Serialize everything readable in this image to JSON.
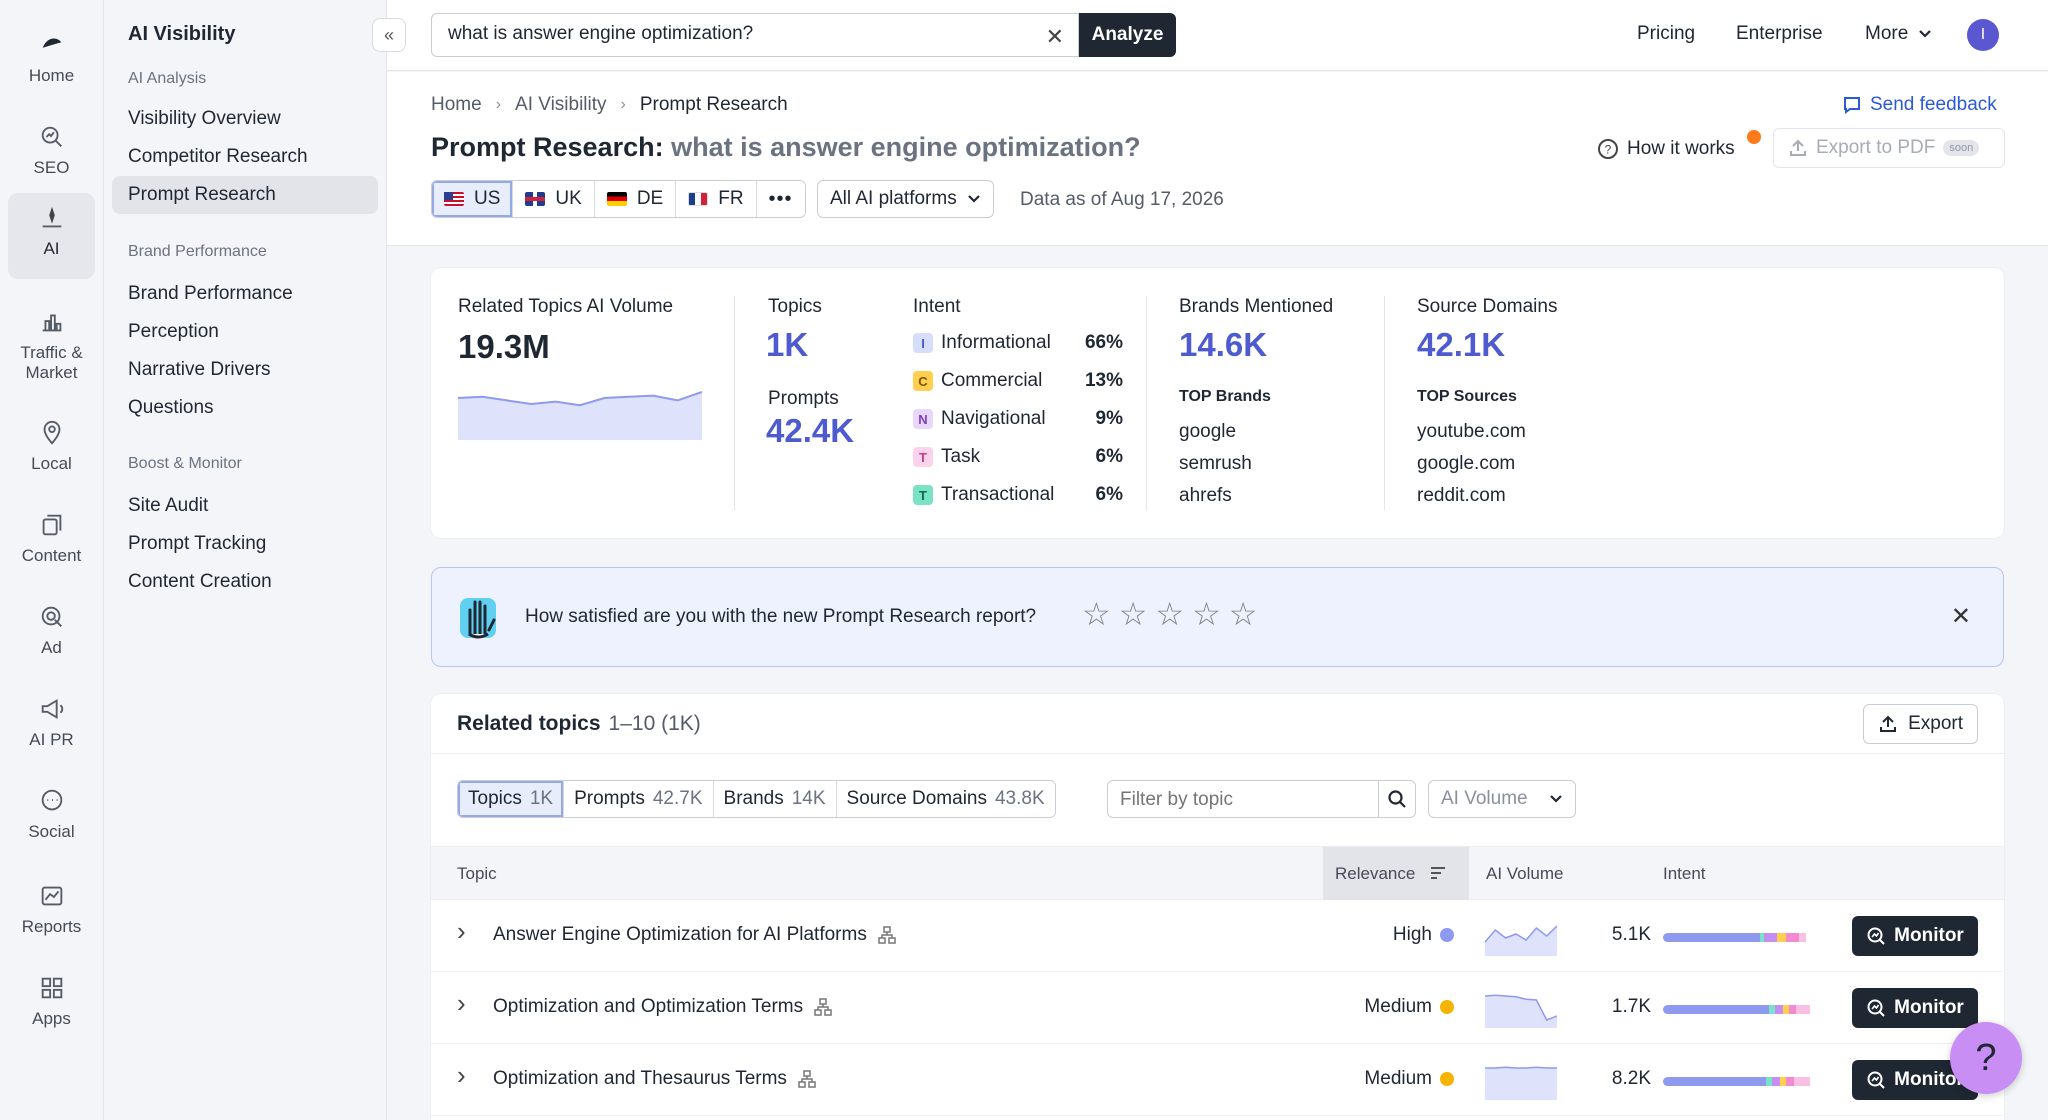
{
  "rail": [
    {
      "label": "Home",
      "icon": "home-icon"
    },
    {
      "label": "SEO",
      "icon": "seo-icon"
    },
    {
      "label": "AI",
      "icon": "ai-icon"
    },
    {
      "label": "Traffic & Market",
      "icon": "chart-icon"
    },
    {
      "label": "Local",
      "icon": "location-icon"
    },
    {
      "label": "Content",
      "icon": "content-icon"
    },
    {
      "label": "Ad",
      "icon": "ad-icon"
    },
    {
      "label": "AI PR",
      "icon": "megaphone-icon"
    },
    {
      "label": "Social",
      "icon": "chat-icon"
    },
    {
      "label": "Reports",
      "icon": "reports-icon"
    },
    {
      "label": "Apps",
      "icon": "apps-icon"
    }
  ],
  "sidebar": {
    "title": "AI Visibility",
    "groups": [
      {
        "label": "AI Analysis",
        "items": [
          "Visibility Overview",
          "Competitor Research",
          "Prompt Research"
        ]
      },
      {
        "label": "Brand Performance",
        "items": [
          "Brand Performance",
          "Perception",
          "Narrative Drivers",
          "Questions"
        ]
      },
      {
        "label": "Boost & Monitor",
        "items": [
          "Site Audit",
          "Prompt Tracking",
          "Content Creation"
        ]
      }
    ]
  },
  "topbar": {
    "search_value": "what is answer engine optimization?",
    "analyze_label": "Analyze",
    "links": [
      "Pricing",
      "Enterprise",
      "More"
    ],
    "avatar_letter": "I"
  },
  "header": {
    "breadcrumbs": [
      "Home",
      "AI Visibility",
      "Prompt Research"
    ],
    "title_prefix": "Prompt Research:",
    "title_query": "what is answer engine optimization?",
    "send_feedback": "Send feedback",
    "how_it_works": "How it works",
    "export_pdf": "Export to PDF",
    "soon": "soon",
    "countries": [
      "US",
      "UK",
      "DE",
      "FR"
    ],
    "more_countries": "•••",
    "platform": "All AI platforms",
    "data_as_of": "Data as of Aug 17, 2026"
  },
  "stats": {
    "volume_label": "Related Topics AI Volume",
    "volume_value": "19.3M",
    "volume_trend": [
      0.7,
      0.72,
      0.66,
      0.6,
      0.64,
      0.58,
      0.7,
      0.72,
      0.74,
      0.66,
      0.8
    ],
    "topics_label": "Topics",
    "topics_value": "1K",
    "prompts_label": "Prompts",
    "prompts_value": "42.4K",
    "intent_label": "Intent",
    "intents": [
      {
        "letter": "I",
        "name": "Informational",
        "pct": "66%",
        "bg": "#d7defb",
        "fg": "#4a5bd0"
      },
      {
        "letter": "C",
        "name": "Commercial",
        "pct": "13%",
        "bg": "#ffcf4d",
        "fg": "#7a5200"
      },
      {
        "letter": "N",
        "name": "Navigational",
        "pct": "9%",
        "bg": "#e9d7fb",
        "fg": "#7b3fc4"
      },
      {
        "letter": "T",
        "name": "Task",
        "pct": "6%",
        "bg": "#fcd3ec",
        "fg": "#c23d8a"
      },
      {
        "letter": "T",
        "name": "Transactional",
        "pct": "6%",
        "bg": "#7be3c5",
        "fg": "#0e6b52"
      }
    ],
    "brands_label": "Brands Mentioned",
    "brands_value": "14.6K",
    "top_brands_label": "TOP Brands",
    "top_brands": [
      "google",
      "semrush",
      "ahrefs"
    ],
    "sources_label": "Source Domains",
    "sources_value": "42.1K",
    "top_sources_label": "TOP Sources",
    "top_sources": [
      "youtube.com",
      "google.com",
      "reddit.com"
    ]
  },
  "survey": {
    "question": "How satisfied are you with the new Prompt Research report?",
    "stars": 5
  },
  "topics": {
    "title": "Related topics",
    "range": "1–10 (1K)",
    "export_label": "Export",
    "tabs": [
      {
        "label": "Topics",
        "count": "1K"
      },
      {
        "label": "Prompts",
        "count": "42.7K"
      },
      {
        "label": "Brands",
        "count": "14K"
      },
      {
        "label": "Source Domains",
        "count": "43.8K"
      }
    ],
    "filter_placeholder": "Filter by topic",
    "volume_select": "AI Volume",
    "columns": [
      "Topic",
      "Relevance",
      "AI Volume",
      "Intent"
    ],
    "monitor_label": "Monitor",
    "rows": [
      {
        "topic": "Answer Engine Optimization for AI Platforms",
        "relevance": "High",
        "dot": "#8e9af0",
        "volume": "5.1K",
        "spark": [
          0.35,
          0.65,
          0.45,
          0.55,
          0.4,
          0.7,
          0.5,
          0.75
        ],
        "intent_mix": [
          0.62,
          0.03,
          0.08,
          0.06,
          0.08,
          0.05
        ]
      },
      {
        "topic": "Optimization and Optimization Terms",
        "relevance": "Medium",
        "dot": "#f4b400",
        "volume": "1.7K",
        "spark": [
          0.8,
          0.82,
          0.8,
          0.78,
          0.72,
          0.7,
          0.2,
          0.3
        ],
        "intent_mix": [
          0.68,
          0.04,
          0.05,
          0.04,
          0.04,
          0.09
        ]
      },
      {
        "topic": "Optimization and Thesaurus Terms",
        "relevance": "Medium",
        "dot": "#f4b400",
        "volume": "8.2K",
        "spark": [
          0.8,
          0.8,
          0.82,
          0.8,
          0.8,
          0.82,
          0.8,
          0.8
        ],
        "intent_mix": [
          0.66,
          0.04,
          0.05,
          0.04,
          0.05,
          0.1
        ]
      }
    ],
    "intent_colors": [
      "#8e9af0",
      "#7be3c5",
      "#c58ef3",
      "#ffcf4d",
      "#f28ad0",
      "#f9c0e4"
    ]
  },
  "help": "?"
}
